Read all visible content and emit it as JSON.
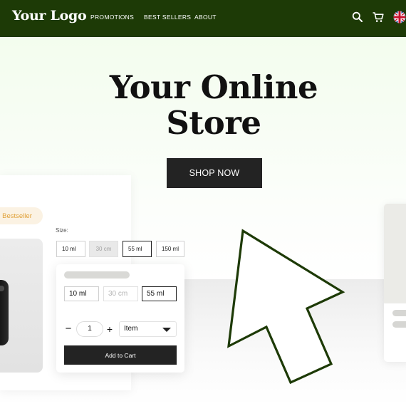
{
  "header": {
    "logo": "Your Logo",
    "nav": [
      {
        "label": "PROMOTIONS"
      },
      {
        "label": "BEST SELLERS"
      },
      {
        "label": "ABOUT"
      }
    ],
    "icons": [
      "search-icon",
      "cart-icon",
      "uk-flag-icon"
    ]
  },
  "hero": {
    "title_line1": "Your Online",
    "title_line2": "Store",
    "cta": "SHOP NOW"
  },
  "product": {
    "badge": "Bestseller",
    "size_label": "Size:",
    "sizes": [
      {
        "label": "10 ml",
        "state": "available"
      },
      {
        "label": "30 cm",
        "state": "disabled"
      },
      {
        "label": "55 ml",
        "state": "selected"
      },
      {
        "label": "150 ml",
        "state": "available"
      }
    ]
  },
  "popover": {
    "sizes": [
      {
        "label": "10 ml",
        "state": "available"
      },
      {
        "label": "30 cm",
        "state": "disabled"
      },
      {
        "label": "55 ml",
        "state": "selected"
      }
    ],
    "quantity": "1",
    "unit": "Item",
    "add_to_cart": "Add to Cart"
  },
  "colors": {
    "header_bg": "#1d3a06",
    "hero_bg": "#f3fdee",
    "button_dark": "#232323",
    "badge_bg": "#fbf2e3",
    "badge_text": "#e0a23a",
    "cursor_stroke": "#1d3a06"
  }
}
